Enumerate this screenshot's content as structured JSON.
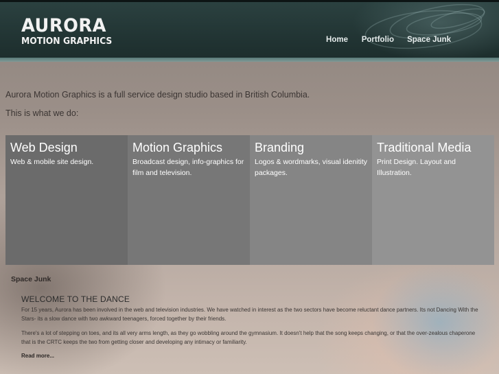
{
  "header": {
    "logo_line1": "AURORA",
    "logo_line2": "MOTION GRAPHICS",
    "nav": [
      "Home",
      "Portfolio",
      "Space Junk"
    ]
  },
  "intro": {
    "line1": "Aurora Motion Graphics is a full service design studio based in British Columbia.",
    "line2": "This is what we do:"
  },
  "services": [
    {
      "title": "Web Design",
      "desc": "Web & mobile site design.",
      "color": "#6b6b6b"
    },
    {
      "title": "Motion Graphics",
      "desc": "Broadcast design, info-graphics for film and television.",
      "color": "#777777"
    },
    {
      "title": "Branding",
      "desc": "Logos & wordmarks, visual idenitity packages.",
      "color": "#858585"
    },
    {
      "title": "Traditional Media",
      "desc": "Print Design. Layout and Illustration.",
      "color": "#939393"
    }
  ],
  "blog": {
    "section_label": "Space Junk",
    "post_title": "WELCOME TO THE DANCE",
    "paragraph1": "For 15 years, Aurora has been involved in the web and television industries. We have watched in interest as the two sectors have become reluctant dance partners. Its not Dancing With the Stars- its a slow dance with two awkward teenagers, forced together by their friends.",
    "paragraph2": "There's a lot of stepping on toes, and its all very arms length, as they go wobbling around the gymnasium. It doesn't help that the song keeps changing, or that the over-zealous chaperone that is the CRTC keeps the two from getting closer and developing any intimacy or familiarity.",
    "read_more": "Read more..."
  }
}
